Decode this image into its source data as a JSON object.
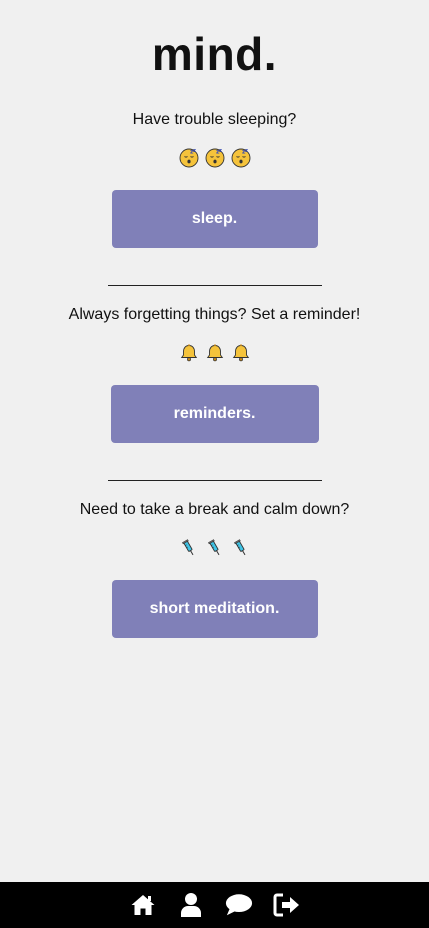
{
  "app": {
    "title": "mind."
  },
  "sections": [
    {
      "prompt": "Have trouble sleeping?",
      "emoji_icon": "sleeping-face-icon",
      "button_label": "sleep."
    },
    {
      "prompt": "Always forgetting things? Set a reminder!",
      "emoji_icon": "bell-icon",
      "button_label": "reminders."
    },
    {
      "prompt": "Need to take a break and calm down?",
      "emoji_icon": "syringe-icon",
      "button_label": "short meditation."
    }
  ],
  "divider_text": "________________________",
  "bottom_nav": {
    "items": [
      {
        "icon": "home-icon"
      },
      {
        "icon": "user-icon"
      },
      {
        "icon": "chat-icon"
      },
      {
        "icon": "logout-icon"
      }
    ]
  },
  "colors": {
    "background": "#f0f0f0",
    "button": "#8080b8",
    "button_text": "#ffffff",
    "nav_bar": "#000000"
  }
}
